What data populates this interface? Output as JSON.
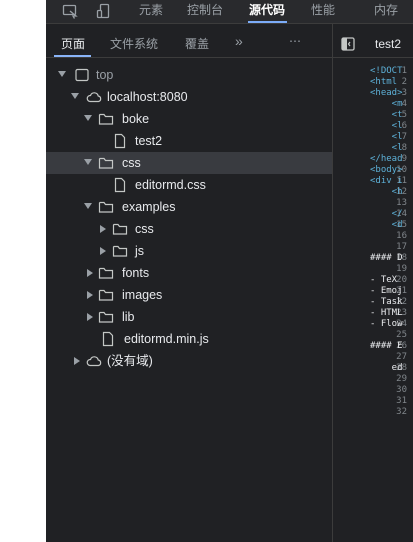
{
  "toolbar": {
    "tabs": [
      "元素",
      "控制台",
      "源代码",
      "性能",
      "内存"
    ],
    "active_tab": "源代码",
    "icons": [
      "inspect-icon",
      "device-toggle-icon"
    ]
  },
  "navigator": {
    "tabs": [
      "页面",
      "文件系统",
      "覆盖"
    ],
    "active_tab": "页面",
    "more": "»",
    "menu": "⋯"
  },
  "tree": [
    {
      "label": "top",
      "kind": "frame",
      "expanded": true
    },
    {
      "label": "localhost:8080",
      "kind": "cloud",
      "expanded": true
    },
    {
      "label": "boke",
      "kind": "folder",
      "expanded": true
    },
    {
      "label": "test2",
      "kind": "file"
    },
    {
      "label": "css",
      "kind": "folder",
      "expanded": true,
      "selected": true
    },
    {
      "label": "editormd.css",
      "kind": "file"
    },
    {
      "label": "examples",
      "kind": "folder",
      "expanded": true
    },
    {
      "label": "css",
      "kind": "folder",
      "expanded": false
    },
    {
      "label": "js",
      "kind": "folder",
      "expanded": false
    },
    {
      "label": "fonts",
      "kind": "folder",
      "expanded": false
    },
    {
      "label": "images",
      "kind": "folder",
      "expanded": false
    },
    {
      "label": "lib",
      "kind": "folder",
      "expanded": false
    },
    {
      "label": "editormd.min.js",
      "kind": "file"
    },
    {
      "label": "(没有域)",
      "kind": "cloud",
      "expanded": false
    }
  ],
  "editor": {
    "tab_label": "test2",
    "toggle_icon": "sidebar-toggle-icon",
    "lines": [
      "<!DOCT",
      "<html",
      "<head>",
      "    <m",
      "    <t",
      "    <l",
      "    <l",
      "    <l",
      "</head",
      "<body>",
      "<div i",
      "    <h",
      "",
      "    </",
      "    <d",
      "",
      "",
      "#### D",
      "",
      "- TeX",
      "- Emoj",
      "- Task",
      "- HTML",
      "- Flow",
      "",
      "#### E",
      "",
      "    ed",
      "",
      "",
      "",
      ""
    ]
  }
}
